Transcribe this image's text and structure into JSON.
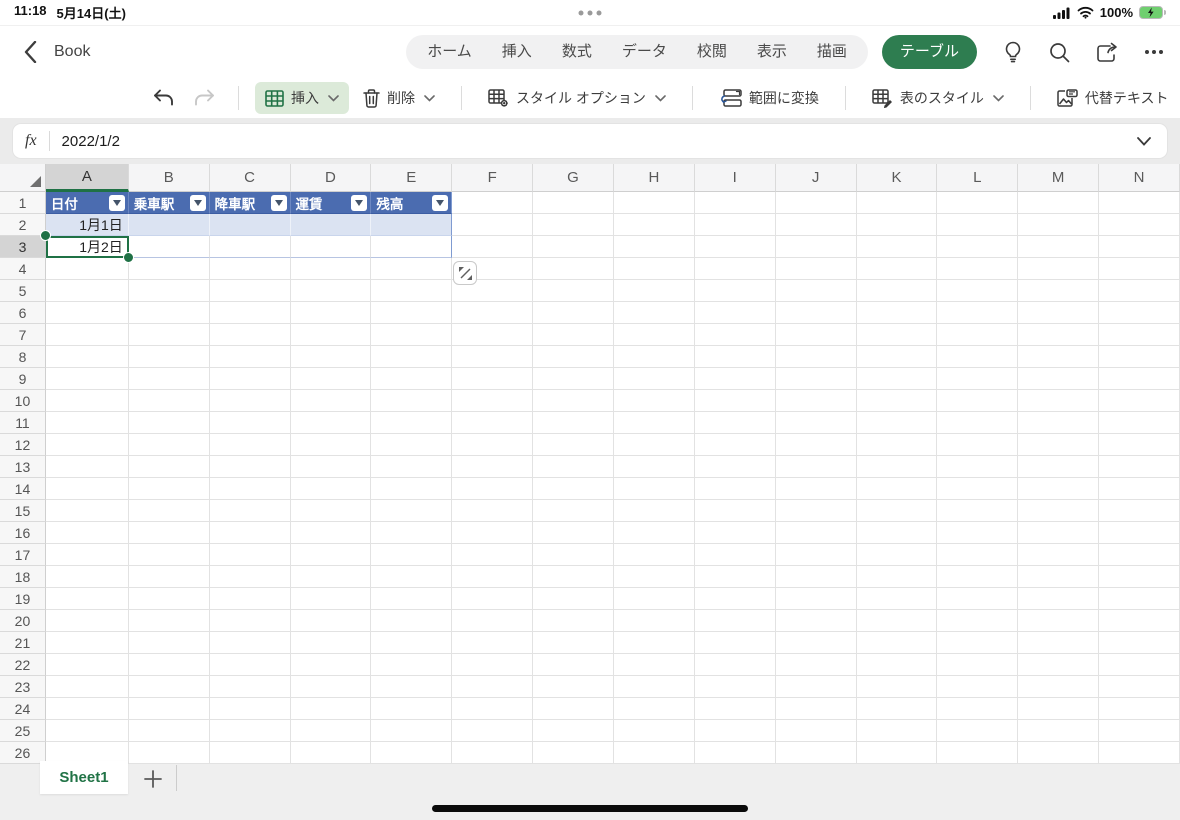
{
  "status_bar": {
    "time": "11:18",
    "date": "5月14日(土)",
    "battery_percent": "100%"
  },
  "nav": {
    "title": "Book",
    "tabs": [
      "ホーム",
      "挿入",
      "数式",
      "データ",
      "校閲",
      "表示",
      "描画"
    ],
    "selected_tab": "テーブル"
  },
  "toolbar": {
    "insert_label": "挿入",
    "delete_label": "削除",
    "style_options_label": "スタイル オプション",
    "convert_to_range_label": "範囲に変換",
    "table_styles_label": "表のスタイル",
    "alt_text_label": "代替テキスト"
  },
  "formula_bar": {
    "fx_label": "fx",
    "value": "2022/1/2"
  },
  "grid": {
    "columns": [
      "A",
      "B",
      "C",
      "D",
      "E",
      "F",
      "G",
      "H",
      "I",
      "J",
      "K",
      "L",
      "M",
      "N"
    ],
    "row_count": 26,
    "selected_column": "A",
    "selected_row": 3,
    "selected_cell": "A3"
  },
  "table_data": {
    "type": "table",
    "headers": [
      "日付",
      "乗車駅",
      "降車駅",
      "運賃",
      "残高"
    ],
    "rows": [
      [
        "1月1日",
        "",
        "",
        "",
        ""
      ],
      [
        "1月2日",
        "",
        "",
        "",
        ""
      ]
    ],
    "header_color": "#4b6cb0",
    "band_color": "#dbe3f2"
  },
  "sheet_bar": {
    "active_sheet": "Sheet1",
    "add_label": "+"
  },
  "colors": {
    "excel_green": "#217346",
    "selected_tab_green": "#2e7d50",
    "selection_green": "#1f7145",
    "insert_button_bg": "#dcead9",
    "battery_green": "#6fcf6f"
  },
  "icons": [
    "signal-icon",
    "wifi-icon",
    "battery-icon",
    "back-icon",
    "lightbulb-icon",
    "search-icon",
    "share-icon",
    "ellipsis-icon",
    "undo-icon",
    "redo-icon",
    "insert-table-icon",
    "trash-icon",
    "style-options-icon",
    "convert-range-icon",
    "table-styles-icon",
    "alt-text-icon",
    "fx-icon",
    "chevron-down-icon",
    "filter-icon",
    "select-all-icon",
    "resize-table-icon",
    "add-sheet-icon"
  ]
}
